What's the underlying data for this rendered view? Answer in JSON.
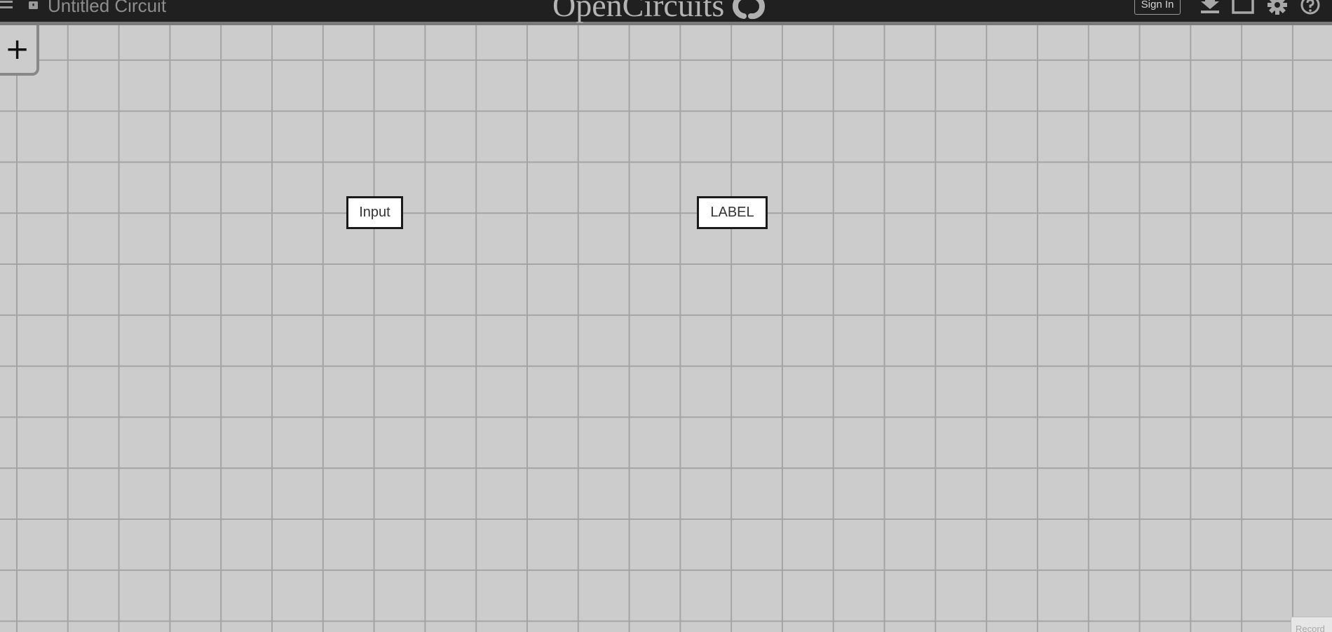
{
  "header": {
    "circuit_name": "Untitled Circuit",
    "brand": "OpenCircuits",
    "sign_in_label": "Sign In",
    "icons": [
      "hamburger-menu-icon",
      "lock-icon",
      "brand-logo-icon",
      "download-icon",
      "screenshot-icon",
      "gear-icon",
      "help-icon"
    ]
  },
  "toolbar": {
    "add_label": "+"
  },
  "canvas": {
    "components": [
      {
        "type": "input",
        "label": "Input"
      },
      {
        "type": "label",
        "label": "LABEL"
      }
    ]
  },
  "footer": {
    "record_label": "Record"
  },
  "colors": {
    "header_bg": "#202020",
    "canvas_bg": "#cccccc",
    "grid_line": "#a4a4a4",
    "component_border": "#1a1a1a"
  }
}
